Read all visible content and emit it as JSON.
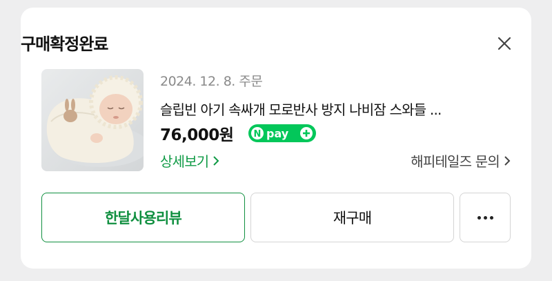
{
  "header": {
    "title": "구매확정완료"
  },
  "order": {
    "date_label": "2024. 12. 8. 주문",
    "product_name": "슬립빈 아기 속싸개 모로반사 방지 나비잠 스와들 ...",
    "price": "76,000원",
    "pay_badge": "Npay+",
    "detail_link": "상세보기",
    "inquiry_link": "해피테일즈 문의"
  },
  "actions": {
    "review_label": "한달사용리뷰",
    "rebuy_label": "재구매",
    "more_icon": "more-horizontal-icon"
  },
  "colors": {
    "accent_green": "#0f8f3f",
    "npay_green": "#03c75a"
  }
}
